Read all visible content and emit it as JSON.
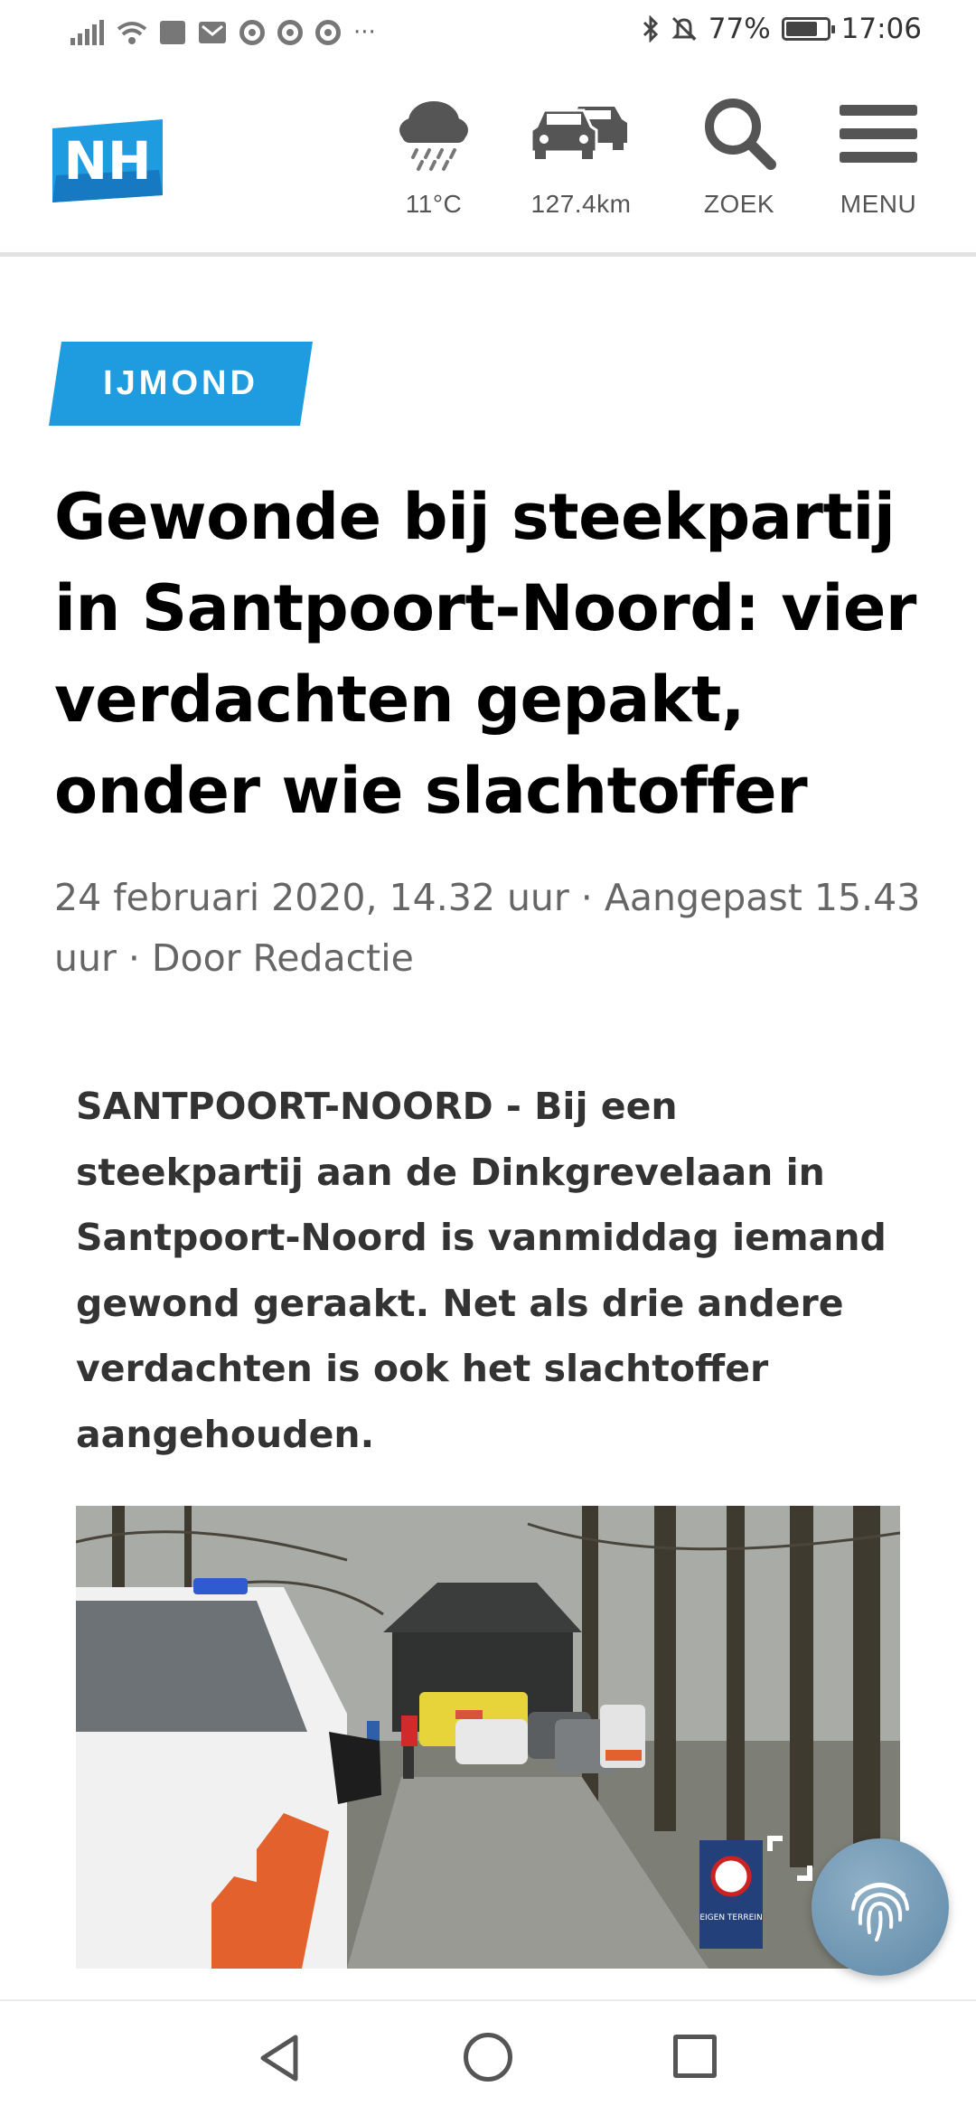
{
  "status_bar": {
    "battery": "77%",
    "battery_level": 0.77,
    "time": "17:06",
    "left_icons": [
      "signal-icon",
      "wifi-icon",
      "sonos-icon",
      "gmail-icon",
      "chrome-icon",
      "chrome-icon",
      "chrome-icon",
      "more-icon"
    ],
    "right_icons": [
      "bluetooth-icon",
      "bell-off-icon",
      "battery-icon"
    ]
  },
  "header": {
    "logo_text": "NH",
    "weather": {
      "icon": "rain-cloud-icon",
      "label": "11°C"
    },
    "traffic": {
      "icon": "cars-icon",
      "label": "127.4km"
    },
    "search": {
      "icon": "search-icon",
      "label": "ZOEK"
    },
    "menu": {
      "icon": "hamburger-icon",
      "label": "MENU"
    }
  },
  "article": {
    "category": "IJMOND",
    "title": "Gewonde bij steekpartij in Santpoort-Noord: vier verdachten gepakt, onder wie slachtoffer",
    "meta": "24 februari 2020, 14.32 uur · Aangepast 15.43 uur · Door Redactie",
    "intro": "SANTPOORT-NOORD - Bij een steekpartij aan de Dinkgrevelaan in Santpoort-Noord is vanmiddag iemand gewond geraakt. Net als drie andere verdachten is ook het slachtoffer aangehouden.",
    "photo_sign_text": "EIGEN TERREIN"
  },
  "colors": {
    "brand_blue": "#1f9ce0",
    "text_dark": "#000000",
    "meta_gray": "#666666"
  },
  "nav_bar": {
    "icons": [
      "back-icon",
      "home-icon",
      "recent-apps-icon"
    ]
  }
}
